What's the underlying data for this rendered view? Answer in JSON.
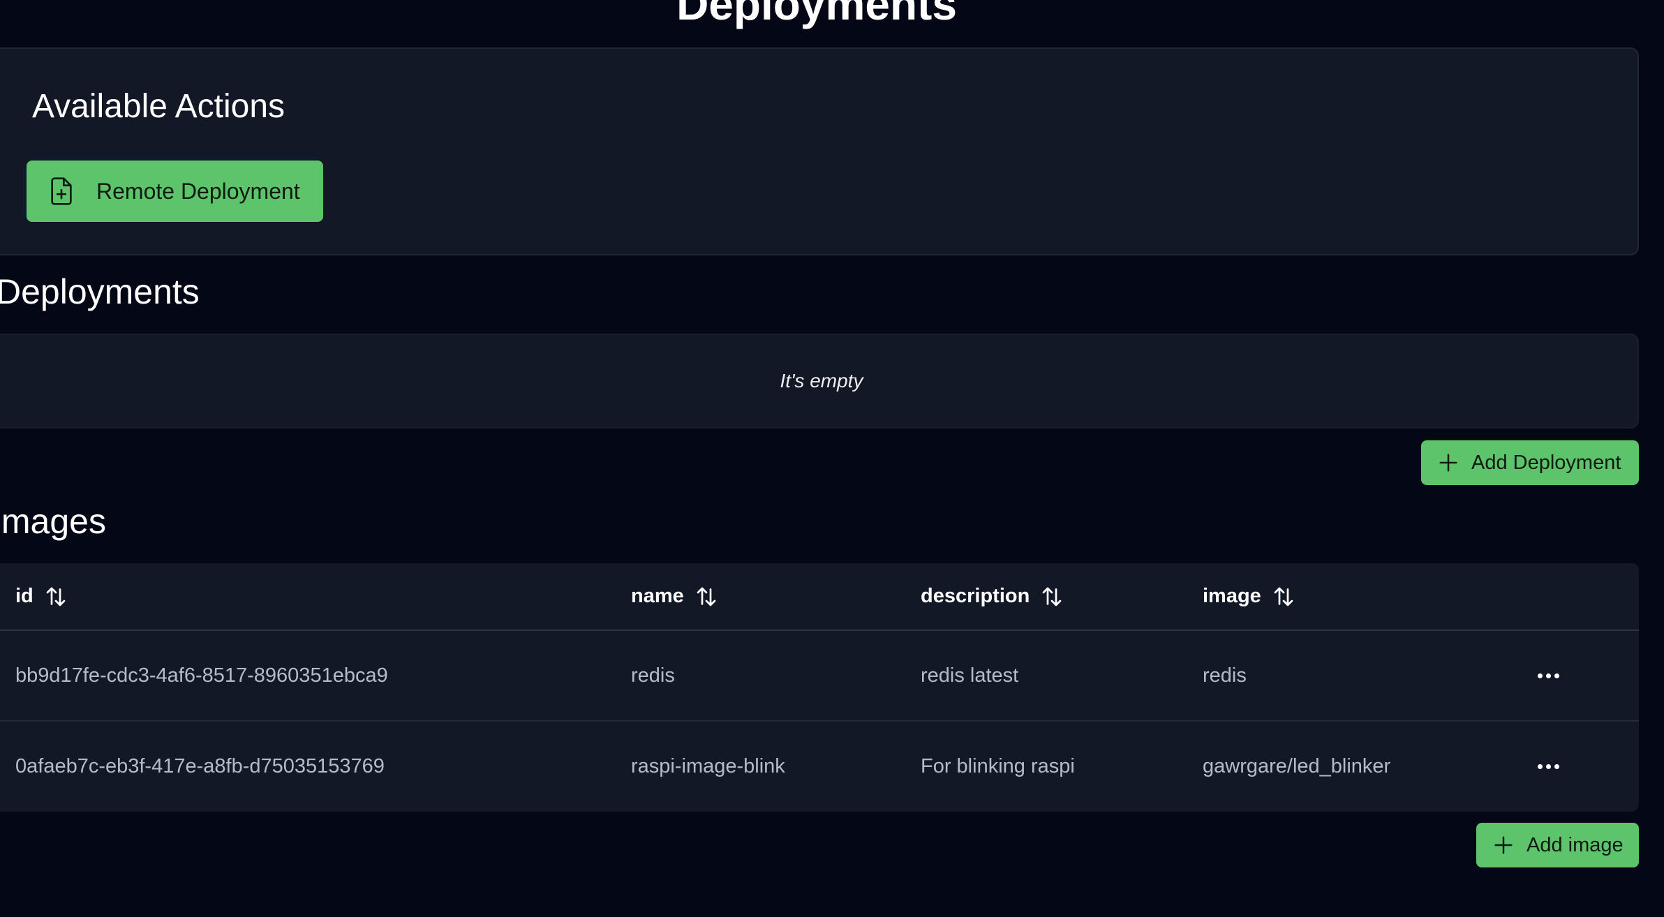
{
  "page": {
    "title": "Deployments"
  },
  "actions": {
    "title": "Available Actions",
    "remote_deployment_label": "Remote Deployment",
    "remote_deployment_icon": "file-plus-icon"
  },
  "deployments": {
    "title": "Deployments",
    "empty_text": "It's empty",
    "add_label": "Add Deployment",
    "add_icon": "plus-icon"
  },
  "images": {
    "title": "Images",
    "columns": [
      "id",
      "name",
      "description",
      "image"
    ],
    "sort_icon": "sort-arrows-icon",
    "rows": [
      {
        "id": "bb9d17fe-cdc3-4af6-8517-8960351ebca9",
        "name": "redis",
        "description": "redis latest",
        "image": "redis"
      },
      {
        "id": "0afaeb7c-eb3f-417e-a8fb-d75035153769",
        "name": "raspi-image-blink",
        "description": "For blinking raspi",
        "image": "gawrgare/led_blinker"
      }
    ],
    "row_menu_icon": "more-horizontal-icon",
    "add_label": "Add image",
    "add_icon": "plus-icon"
  },
  "colors": {
    "background": "#040816",
    "card": "#121826",
    "accent_green": "#5dc46b",
    "muted_text": "#b6bcc7"
  }
}
